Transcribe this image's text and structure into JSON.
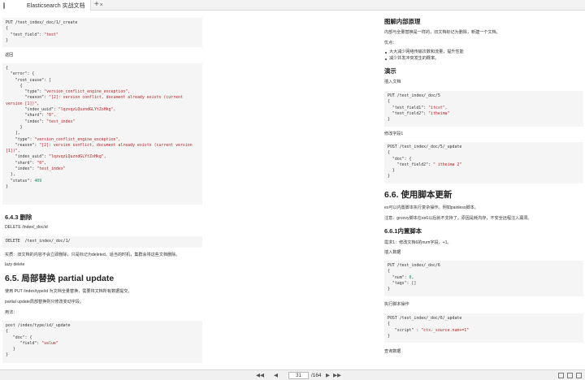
{
  "tab": {
    "title": "Elasticsearch 实战文档",
    "close": "×",
    "new_tab": "+"
  },
  "left": {
    "code1": [
      [
        [
          "PUT /test_index/_doc/1/_create",
          ""
        ]
      ],
      [
        [
          "{",
          ""
        ]
      ],
      [
        [
          "  \"test_field\": ",
          ""
        ],
        [
          "\"test\"",
          "s"
        ]
      ],
      [
        [
          "}",
          ""
        ]
      ]
    ],
    "returns_label": "返回",
    "code2": [
      [
        [
          "{",
          ""
        ]
      ],
      [
        [
          "  \"error\": {",
          ""
        ]
      ],
      [
        [
          "    \"root_cause\": [",
          ""
        ]
      ],
      [
        [
          "      {",
          ""
        ]
      ],
      [
        [
          "        \"type\": ",
          ""
        ],
        [
          "\"version_conflict_engine_exception\",",
          "s"
        ]
      ],
      [
        [
          "        \"reason\": ",
          ""
        ],
        [
          "\"[2]: version conflict, document already exists (current",
          "s"
        ]
      ],
      [
        [
          "version [1])\",",
          "s"
        ]
      ],
      [
        [
          "        \"index_uuid\": ",
          ""
        ],
        [
          "\"lqzvqzLQuzndGLYtZoHkg\",",
          "s"
        ]
      ],
      [
        [
          "        \"shard\": ",
          ""
        ],
        [
          "\"0\",",
          "s"
        ]
      ],
      [
        [
          "        \"index\": ",
          ""
        ],
        [
          "\"test_index\"",
          "s"
        ]
      ],
      [
        [
          "      }",
          ""
        ]
      ],
      [
        [
          "    ],",
          ""
        ]
      ],
      [
        [
          "    \"type\": ",
          ""
        ],
        [
          "\"version_conflict_engine_exception\",",
          "s"
        ]
      ],
      [
        [
          "    \"reason\": ",
          ""
        ],
        [
          "\"[2]: version conflict, document already exists (current version",
          "s"
        ]
      ],
      [
        [
          "[1])\",",
          "s"
        ]
      ],
      [
        [
          "    \"index_uuid\": ",
          ""
        ],
        [
          "\"lqzvqzLQuzndGLYtZoHkg\",",
          "s"
        ]
      ],
      [
        [
          "    \"shard\": ",
          ""
        ],
        [
          "\"0\",",
          "s"
        ]
      ],
      [
        [
          "    \"index\": ",
          ""
        ],
        [
          "\"test_index\"",
          "s"
        ]
      ],
      [
        [
          "  },",
          ""
        ]
      ],
      [
        [
          "  \"status\": ",
          ""
        ],
        [
          "409",
          "n"
        ]
      ],
      [
        [
          "}",
          ""
        ]
      ]
    ],
    "h_delete": "6.4.3 删除",
    "delete_path": "DELETE /index/_doc/id",
    "code3": [
      [
        [
          "DELETE  /test_index/_doc/1/",
          ""
        ]
      ]
    ],
    "delete_note": "实质：旧文档的内容不会立即删除，只是标记为deleted。适当的时机，集群会将这些文档删除。",
    "lazy_delete": "lazy delete",
    "h_partial": "6.5.  局部替换 partial update",
    "partial_desc": "使用 PUT /index/type/id 为文档全量替换，需要将文档所有数据提交。",
    "partial_desc2": "partial update局部替换则只修改变动字段。",
    "usage_label": "用法：",
    "code4": [
      [
        [
          "post /index/type/id/_update",
          ""
        ]
      ],
      [
        [
          "{",
          ""
        ]
      ],
      [
        [
          "   \"doc\": {",
          ""
        ]
      ],
      [
        [
          "      \"field\": ",
          ""
        ],
        [
          "\"value\"",
          "s"
        ]
      ],
      [
        [
          "   }",
          ""
        ]
      ],
      [
        [
          "}",
          ""
        ]
      ]
    ]
  },
  "right": {
    "h_principle": "图解内部原理",
    "principle_desc": "内部与全量替换是一样的，旧文档标记为删除，新建一个文档。",
    "advantages_label": "优点：",
    "adv_items": [
      "大大减少网络传输次数和流量，提升性能",
      "减少并发冲突发生的概率。"
    ],
    "h_demo": "演示",
    "insert_doc_label": "插入文档",
    "code5": [
      [
        [
          "PUT /test_index/_doc/5",
          ""
        ]
      ],
      [
        [
          "{",
          ""
        ]
      ],
      [
        [
          "  \"test_field1\": ",
          ""
        ],
        [
          "\"itcst\",",
          "s"
        ]
      ],
      [
        [
          "  \"test_field2\": ",
          ""
        ],
        [
          "\"itheima\"",
          "s"
        ]
      ],
      [
        [
          "}",
          ""
        ]
      ]
    ],
    "modify_field_label": "修改字段1",
    "code6": [
      [
        [
          "POST /test_index/_doc/5/_update",
          ""
        ]
      ],
      [
        [
          "{",
          ""
        ]
      ],
      [
        [
          "  \"doc\": {",
          ""
        ]
      ],
      [
        [
          "    \"test_field2\": ",
          ""
        ],
        [
          "\" itheima 2\"",
          "s"
        ]
      ],
      [
        [
          "  }",
          ""
        ]
      ],
      [
        [
          "}",
          ""
        ]
      ]
    ],
    "h_script": "6.6.  使用脚本更新",
    "script_desc": "es可以内置脚本执行复杂操作。例如painless脚本。",
    "script_note": "注意：groovy脚本在es6以后就不支持了。原因是耗内存，不安全远程注入漏洞。",
    "h_builtin": "6.6.1内置脚本",
    "need1": "需求1：修改文档6的num字段，+1。",
    "insert_data_label": "插入数据",
    "code7": [
      [
        [
          "PUT /test_index/_doc/6",
          ""
        ]
      ],
      [
        [
          "{",
          ""
        ]
      ],
      [
        [
          "  \"num\": ",
          ""
        ],
        [
          "0",
          "n"
        ],
        [
          ",",
          ""
        ]
      ],
      [
        [
          "  \"tags\": []",
          ""
        ]
      ],
      [
        [
          "}",
          ""
        ]
      ]
    ],
    "exec_label": "执行脚本操作",
    "code8": [
      [
        [
          "POST /test_index/_doc/6/_update",
          ""
        ]
      ],
      [
        [
          "{",
          ""
        ]
      ],
      [
        [
          "   \"script\" : ",
          ""
        ],
        [
          "\"ctx._source.num+=1\"",
          "s"
        ]
      ],
      [
        [
          "}",
          ""
        ]
      ]
    ],
    "query_label": "查询数据"
  },
  "statusbar": {
    "first": "◀◀",
    "prev": "◀",
    "current_page": "31",
    "total": "/164",
    "next": "▶",
    "last": "▶▶"
  }
}
